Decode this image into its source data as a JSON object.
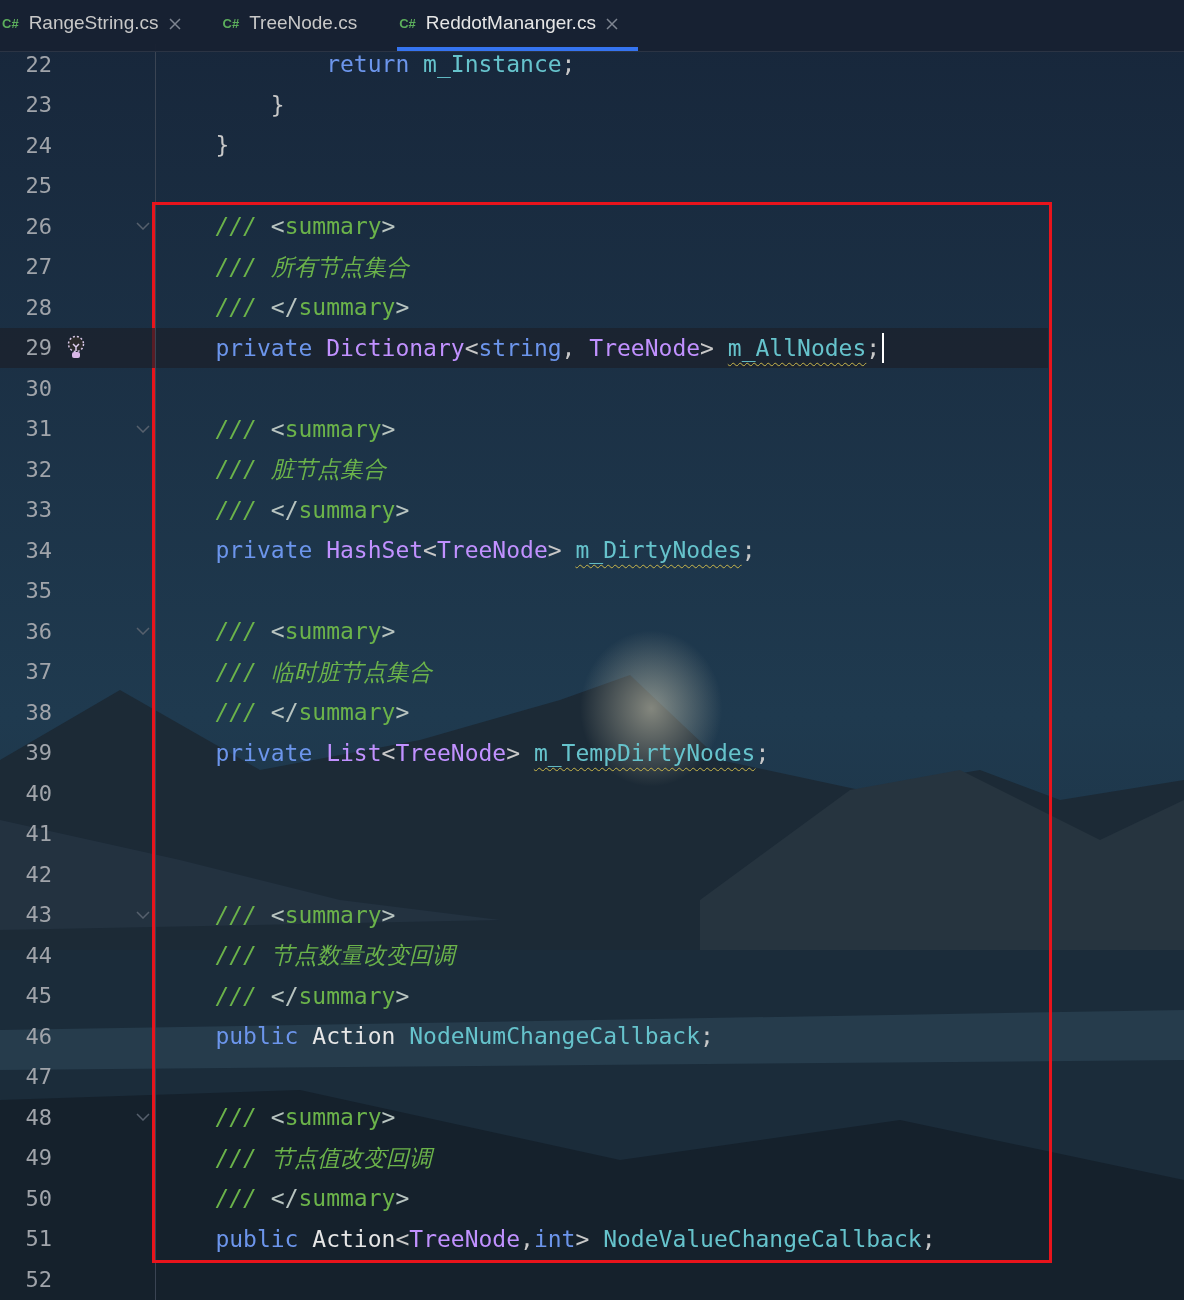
{
  "tabs": [
    {
      "badge": "C#",
      "label": "RangeString.cs",
      "selected": false,
      "closable": true
    },
    {
      "badge": "C#",
      "label": "TreeNode.cs",
      "selected": false,
      "closable": false
    },
    {
      "badge": "C#",
      "label": "ReddotMananger.cs",
      "selected": true,
      "closable": true
    }
  ],
  "code": [
    {
      "kind": "plain",
      "lines": [
        {
          "number": "22",
          "tokens": [
            {
              "kind": "keyword",
              "text": "            return "
            },
            {
              "kind": "field",
              "text": "m_Instance"
            },
            {
              "kind": "punct",
              "text": ";"
            }
          ]
        },
        {
          "number": "23",
          "tokens": [
            {
              "kind": "punct",
              "text": "        }"
            }
          ]
        },
        {
          "number": "24",
          "tokens": [
            {
              "kind": "punct",
              "text": "    }"
            }
          ]
        },
        {
          "number": "25"
        }
      ]
    },
    {
      "kind": "highlight-box",
      "lines": [
        {
          "number": "26",
          "fold": true,
          "tokens": [
            {
              "kind": "comment",
              "text": "    /// "
            },
            {
              "kind": "doc-bracket",
              "text": "<"
            },
            {
              "kind": "doc-tag",
              "text": "summary"
            },
            {
              "kind": "doc-bracket",
              "text": ">"
            }
          ]
        },
        {
          "number": "27",
          "tokens": [
            {
              "kind": "comment",
              "text": "    /// 所有节点集合"
            }
          ]
        },
        {
          "number": "28",
          "tokens": [
            {
              "kind": "comment",
              "text": "    /// "
            },
            {
              "kind": "doc-bracket",
              "text": "</"
            },
            {
              "kind": "doc-tag",
              "text": "summary"
            },
            {
              "kind": "doc-bracket",
              "text": ">"
            }
          ]
        },
        {
          "number": "29",
          "current": true,
          "hint": true,
          "cursor": true,
          "tokens": [
            {
              "kind": "keyword",
              "text": "    private "
            },
            {
              "kind": "type",
              "text": "Dictionary"
            },
            {
              "kind": "punct",
              "text": "<"
            },
            {
              "kind": "keyword",
              "text": "string"
            },
            {
              "kind": "punct",
              "text": ", "
            },
            {
              "kind": "type",
              "text": "TreeNode"
            },
            {
              "kind": "punct",
              "text": "> "
            },
            {
              "kind": "field",
              "text": "m_AllNodes",
              "warning": true
            },
            {
              "kind": "punct",
              "text": ";"
            }
          ]
        },
        {
          "number": "30"
        },
        {
          "number": "31",
          "fold": true,
          "tokens": [
            {
              "kind": "comment",
              "text": "    /// "
            },
            {
              "kind": "doc-bracket",
              "text": "<"
            },
            {
              "kind": "doc-tag",
              "text": "summary"
            },
            {
              "kind": "doc-bracket",
              "text": ">"
            }
          ]
        },
        {
          "number": "32",
          "tokens": [
            {
              "kind": "comment",
              "text": "    /// 脏节点集合"
            }
          ]
        },
        {
          "number": "33",
          "tokens": [
            {
              "kind": "comment",
              "text": "    /// "
            },
            {
              "kind": "doc-bracket",
              "text": "</"
            },
            {
              "kind": "doc-tag",
              "text": "summary"
            },
            {
              "kind": "doc-bracket",
              "text": ">"
            }
          ]
        },
        {
          "number": "34",
          "tokens": [
            {
              "kind": "keyword",
              "text": "    private "
            },
            {
              "kind": "type",
              "text": "HashSet"
            },
            {
              "kind": "punct",
              "text": "<"
            },
            {
              "kind": "type",
              "text": "TreeNode"
            },
            {
              "kind": "punct",
              "text": "> "
            },
            {
              "kind": "field",
              "text": "m_DirtyNodes",
              "warning": true
            },
            {
              "kind": "punct",
              "text": ";"
            }
          ]
        },
        {
          "number": "35"
        },
        {
          "number": "36",
          "fold": true,
          "tokens": [
            {
              "kind": "comment",
              "text": "    /// "
            },
            {
              "kind": "doc-bracket",
              "text": "<"
            },
            {
              "kind": "doc-tag",
              "text": "summary"
            },
            {
              "kind": "doc-bracket",
              "text": ">"
            }
          ]
        },
        {
          "number": "37",
          "tokens": [
            {
              "kind": "comment",
              "text": "    /// 临时脏节点集合"
            }
          ]
        },
        {
          "number": "38",
          "tokens": [
            {
              "kind": "comment",
              "text": "    /// "
            },
            {
              "kind": "doc-bracket",
              "text": "</"
            },
            {
              "kind": "doc-tag",
              "text": "summary"
            },
            {
              "kind": "doc-bracket",
              "text": ">"
            }
          ]
        },
        {
          "number": "39",
          "tokens": [
            {
              "kind": "keyword",
              "text": "    private "
            },
            {
              "kind": "type",
              "text": "List"
            },
            {
              "kind": "punct",
              "text": "<"
            },
            {
              "kind": "type",
              "text": "TreeNode"
            },
            {
              "kind": "punct",
              "text": "> "
            },
            {
              "kind": "field",
              "text": "m_TempDirtyNodes",
              "warning": true
            },
            {
              "kind": "punct",
              "text": ";"
            }
          ]
        },
        {
          "number": "40"
        },
        {
          "number": "41"
        },
        {
          "number": "42"
        },
        {
          "number": "43",
          "fold": true,
          "tokens": [
            {
              "kind": "comment",
              "text": "    /// "
            },
            {
              "kind": "doc-bracket",
              "text": "<"
            },
            {
              "kind": "doc-tag",
              "text": "summary"
            },
            {
              "kind": "doc-bracket",
              "text": ">"
            }
          ]
        },
        {
          "number": "44",
          "tokens": [
            {
              "kind": "comment",
              "text": "    /// 节点数量改变回调"
            }
          ]
        },
        {
          "number": "45",
          "tokens": [
            {
              "kind": "comment",
              "text": "    /// "
            },
            {
              "kind": "doc-bracket",
              "text": "</"
            },
            {
              "kind": "doc-tag",
              "text": "summary"
            },
            {
              "kind": "doc-bracket",
              "text": ">"
            }
          ]
        },
        {
          "number": "46",
          "tokens": [
            {
              "kind": "keyword",
              "text": "    public "
            },
            {
              "kind": "delegate",
              "text": "Action "
            },
            {
              "kind": "field",
              "text": "NodeNumChangeCallback"
            },
            {
              "kind": "punct",
              "text": ";"
            }
          ]
        },
        {
          "number": "47"
        },
        {
          "number": "48",
          "fold": true,
          "tokens": [
            {
              "kind": "comment",
              "text": "    /// "
            },
            {
              "kind": "doc-bracket",
              "text": "<"
            },
            {
              "kind": "doc-tag",
              "text": "summary"
            },
            {
              "kind": "doc-bracket",
              "text": ">"
            }
          ]
        },
        {
          "number": "49",
          "tokens": [
            {
              "kind": "comment",
              "text": "    /// 节点值改变回调"
            }
          ]
        },
        {
          "number": "50",
          "tokens": [
            {
              "kind": "comment",
              "text": "    /// "
            },
            {
              "kind": "doc-bracket",
              "text": "</"
            },
            {
              "kind": "doc-tag",
              "text": "summary"
            },
            {
              "kind": "doc-bracket",
              "text": ">"
            }
          ]
        },
        {
          "number": "51",
          "tokens": [
            {
              "kind": "keyword",
              "text": "    public "
            },
            {
              "kind": "delegate",
              "text": "Action"
            },
            {
              "kind": "punct",
              "text": "<"
            },
            {
              "kind": "type",
              "text": "TreeNode"
            },
            {
              "kind": "punct",
              "text": ","
            },
            {
              "kind": "keyword",
              "text": "int"
            },
            {
              "kind": "punct",
              "text": "> "
            },
            {
              "kind": "field",
              "text": "NodeValueChangeCallback"
            },
            {
              "kind": "punct",
              "text": ";"
            }
          ]
        }
      ]
    },
    {
      "kind": "plain",
      "lines": [
        {
          "number": "52"
        }
      ]
    }
  ]
}
